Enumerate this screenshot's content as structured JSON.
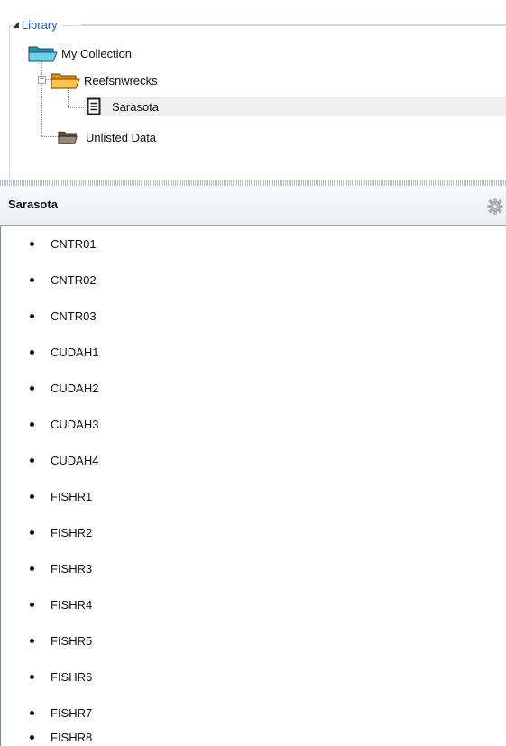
{
  "library": {
    "header": "Library",
    "nodes": [
      {
        "label": "My Collection",
        "icon": "folder-blue-icon"
      },
      {
        "label": "Reefsnwrecks",
        "icon": "folder-orange-icon",
        "expander": "−"
      },
      {
        "label": "Sarasota",
        "icon": "document-icon",
        "selected": true
      },
      {
        "label": "Unlisted Data",
        "icon": "folder-gray-icon"
      }
    ]
  },
  "details": {
    "title": "Sarasota",
    "settings_icon": "gear-icon",
    "items": [
      "CNTR01",
      "CNTR02",
      "CNTR03",
      "CUDAH1",
      "CUDAH2",
      "CUDAH3",
      "CUDAH4",
      "FISHR1",
      "FISHR2",
      "FISHR3",
      "FISHR4",
      "FISHR5",
      "FISHR6",
      "FISHR7",
      "FISHR8"
    ]
  },
  "colors": {
    "library_header": "#1f5fb0",
    "folder_blue": "#3db3d6",
    "folder_orange": "#f7a51e",
    "folder_gray": "#7d6c5c",
    "selected_row": "#f0f0f0"
  }
}
